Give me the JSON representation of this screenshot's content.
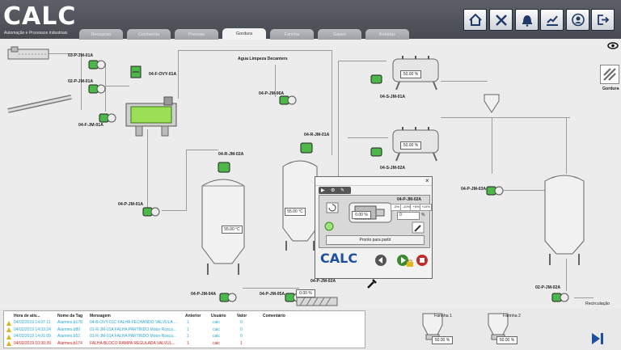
{
  "brand": {
    "logo_text": "CALC",
    "subtitle": "Automação e Processos Industriais"
  },
  "header": {
    "buttons": [
      {
        "name": "home-button",
        "icon": "home-icon"
      },
      {
        "name": "tools-button",
        "icon": "tools-icon"
      },
      {
        "name": "alarm-bell-button",
        "icon": "bell-icon"
      },
      {
        "name": "trend-chart-button",
        "icon": "chart-icon"
      },
      {
        "name": "user-button",
        "icon": "user-icon"
      },
      {
        "name": "logout-button",
        "icon": "logout-icon"
      }
    ]
  },
  "tabs": [
    "Recepcao",
    "Cozimento",
    "Prensas",
    "Gordura",
    "Farinha",
    "Gases",
    "Bebidas"
  ],
  "active_tab": "Gordura",
  "process": {
    "side_label": "Gordura",
    "water_label": "Agua Limpeza Decanters",
    "equipment": {
      "p03": "03-P-JM-01A",
      "p02": "02-P-JM-01A",
      "vv": "04-F-OVY-01A",
      "f04": "04-F-JM-01A",
      "p04a": "04-P-JM-06A",
      "r04": "04-R-JM-02A",
      "r04b": "04-R-JM-01A",
      "s01": "04-S-JM-01A",
      "s02": "04-S-JM-02A",
      "p04": "04-P-JM-01A",
      "p04c": "04-P-JM-03A",
      "p04d": "04-P-JM-04A",
      "p05": "04-P-JM-05A",
      "p02a": "04-P-JM-02A",
      "p02b": "02-P-JM-02A"
    },
    "values": {
      "tank_temp_1": "55.00 °C",
      "tank_temp_2": "55.00 °C",
      "sep_1": "50.00 %",
      "sep_2": "50.00 %",
      "screw": "0.00 %"
    },
    "recirc_label": "Recirculação"
  },
  "popup": {
    "title": "04-P-JM-02A",
    "value": "0.00 %",
    "setpoint": "0",
    "unit": "%",
    "steps": [
      "-5%",
      "-10%",
      "+5%",
      "+10%"
    ],
    "status": "Pronto para partir",
    "close": "×"
  },
  "alarm_table": {
    "headers": [
      "Hora de ativ...",
      "Nome da Tag",
      "Mensagem",
      "Anterior",
      "Usuário",
      "Valor",
      "Comentário"
    ],
    "rows": [
      {
        "time": "04/02/2019 14:07:11",
        "tag": "Alarmes.b178",
        "msg": "04-B-OVY-01C FALHA FECHANDO VALVULA ...",
        "prev": "1",
        "user": "calc",
        "val": "0",
        "color": "#2aa6d9"
      },
      {
        "time": "04/02/2019 14:03:24",
        "tag": "Alarmes.b80",
        "msg": "01-R-JM-01A FALHA PARTINDO Motor Rosca...",
        "prev": "1",
        "user": "calc",
        "val": "0",
        "color": "#2aa6d9"
      },
      {
        "time": "04/02/2019 14:01:09",
        "tag": "Alarmes.b52",
        "msg": "01-R-JM-01A FALHA PARTINDO Motor Rosca...",
        "prev": "1",
        "user": "calc",
        "val": "0",
        "color": "#2aa6d9"
      },
      {
        "time": "04/02/2019 10:30:39",
        "tag": "Alarmes.b174",
        "msg": "FALHA BLOCO RAMPA REGULADA VALVUL...",
        "prev": "1",
        "user": "calc",
        "val": "1",
        "color": "#d42020"
      }
    ]
  },
  "silos": [
    {
      "label": "Farinha 1",
      "value": "50.00 %"
    },
    {
      "label": "Farinha 2",
      "value": "50.00 %"
    }
  ],
  "colors": {
    "pump": "#4db84a",
    "header": "#4f5359",
    "accent": "#1f4fa0"
  }
}
